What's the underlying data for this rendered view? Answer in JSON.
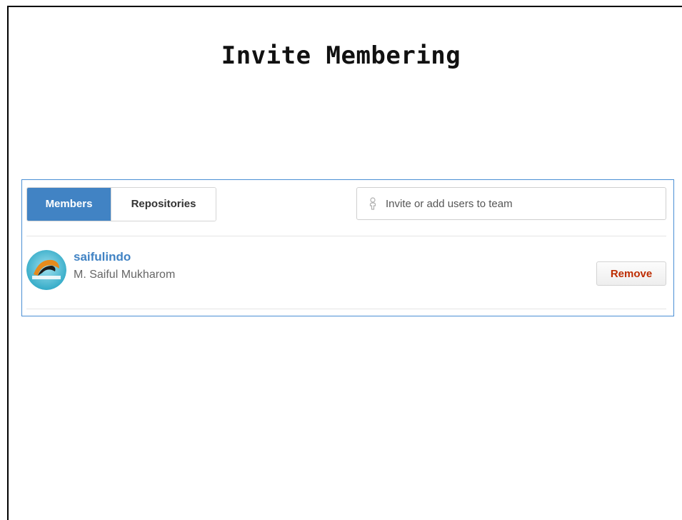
{
  "slide": {
    "title": "Invite Membering"
  },
  "tabs": [
    {
      "label": "Members",
      "active": true
    },
    {
      "label": "Repositories",
      "active": false
    }
  ],
  "invite": {
    "placeholder": "Invite or add users to team",
    "icon": "person-icon"
  },
  "members": [
    {
      "login": "saifulindo",
      "name": "M. Saiful Mukharom",
      "action_label": "Remove",
      "avatar_icon": "avatar"
    }
  ],
  "colors": {
    "accent": "#4183c4",
    "danger": "#bd2c00",
    "panel_border": "#4a8fd4"
  }
}
